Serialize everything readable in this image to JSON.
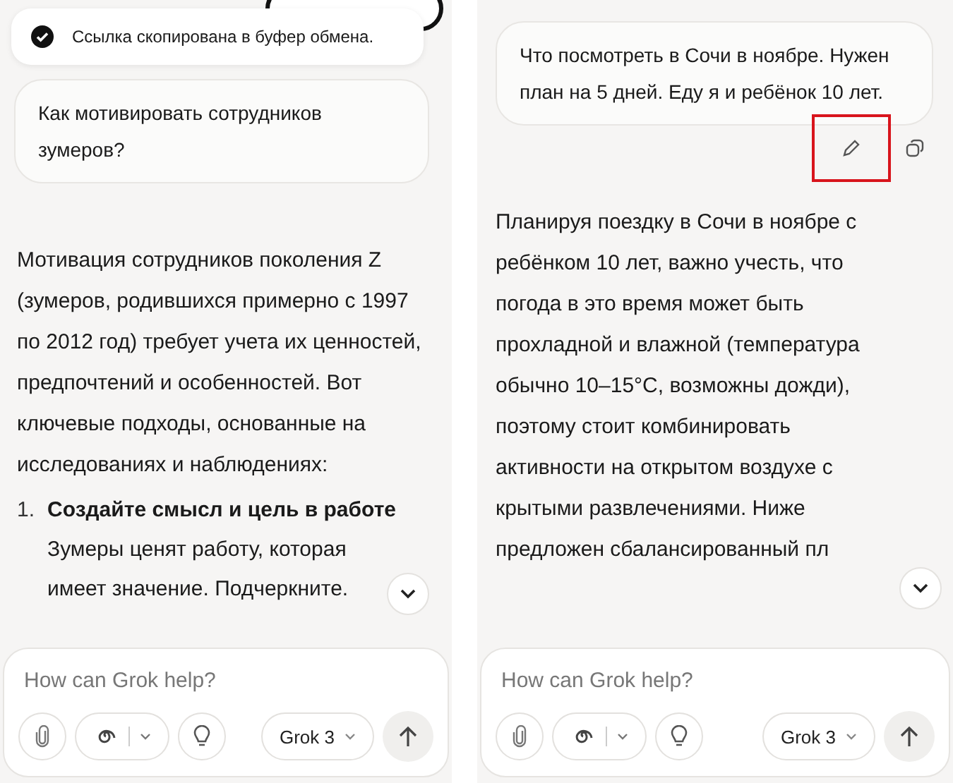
{
  "panels": [
    {
      "toast": {
        "text": "Ссылка скопирована в буфер обмена."
      },
      "user_message": "Как мотивировать сотрудников зумеров?",
      "answer": "Мотивация сотрудников поколения Z (зумеров, родившихся примерно с 1997 по 2012 год) требует учета их ценностей, предпочтений и особенностей. Вот ключевые подходы, основанные на исследованиях и наблюдениях:",
      "list": [
        {
          "number": "1.",
          "title": "Создайте смысл и цель в работе",
          "text": "Зумеры ценят работу, которая имеет значение. Подчеркните."
        }
      ],
      "composer": {
        "placeholder": "How can Grok help?",
        "model": "Grok 3"
      }
    },
    {
      "user_message": "Что посмотреть в Сочи в ноябре. Нужен план на 5 дней. Еду я и ребёнок 10 лет.",
      "actions": [
        {
          "kind": "edit",
          "highlighted": true
        },
        {
          "kind": "copy",
          "highlighted": false
        }
      ],
      "answer": "Планируя поездку в Сочи в ноябре с ребёнком 10 лет, важно учесть, что погода в это время может быть прохладной и влажной (температура обычно 10–15°C, возможны дожди), поэтому стоит комбинировать активности на открытом воздухе с крытыми развлечениями. Ниже предложен сбалансированный пл",
      "composer": {
        "placeholder": "How can Grok help?",
        "model": "Grok 3"
      }
    }
  ]
}
